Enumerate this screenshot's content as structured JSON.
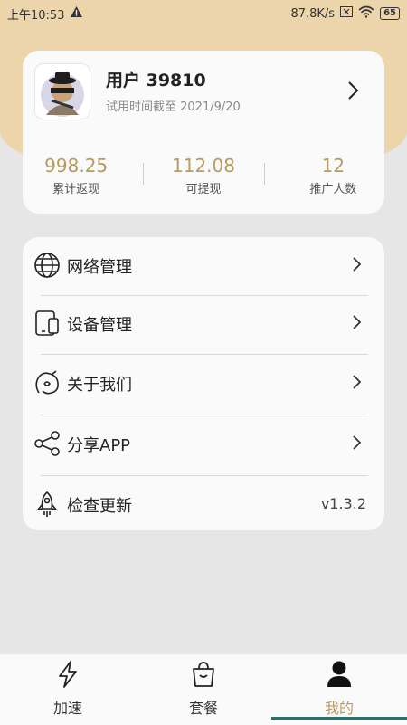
{
  "status_bar": {
    "time": "上午10:53",
    "speed": "87.8K/s",
    "battery": "65"
  },
  "profile": {
    "username": "用户 39810",
    "trial_text": "试用时间截至 2021/9/20",
    "stats": [
      {
        "value": "998.25",
        "label": "累计返现"
      },
      {
        "value": "112.08",
        "label": "可提现"
      },
      {
        "value": "12",
        "label": "推广人数"
      }
    ]
  },
  "menu": {
    "items": [
      {
        "label": "网络管理",
        "icon": "globe-icon"
      },
      {
        "label": "设备管理",
        "icon": "device-icon"
      },
      {
        "label": "关于我们",
        "icon": "about-icon"
      },
      {
        "label": "分享APP",
        "icon": "share-icon"
      },
      {
        "label": "检查更新",
        "icon": "rocket-icon",
        "value": "v1.3.2"
      }
    ]
  },
  "tabbar": {
    "tabs": [
      {
        "label": "加速",
        "icon": "lightning-icon"
      },
      {
        "label": "套餐",
        "icon": "bag-icon"
      },
      {
        "label": "我的",
        "icon": "user-icon"
      }
    ],
    "active_index": 2
  },
  "colors": {
    "accent": "#b89b5e",
    "header_bg": "#ecd5aa",
    "indicator": "#2f6f6a"
  }
}
